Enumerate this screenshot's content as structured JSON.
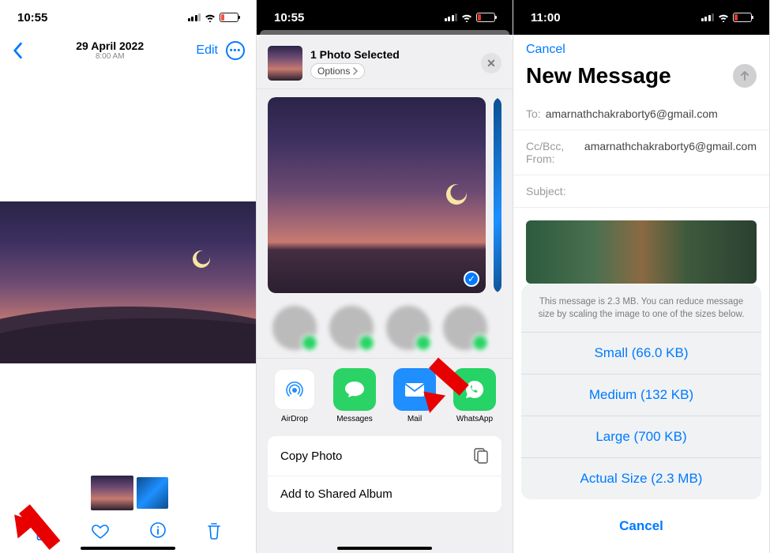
{
  "panel1": {
    "status": {
      "time": "10:55"
    },
    "nav": {
      "date": "29 April 2022",
      "time": "8:00 AM",
      "edit": "Edit"
    }
  },
  "panel2": {
    "status": {
      "time": "10:55"
    },
    "sheet": {
      "title": "1 Photo Selected",
      "options_label": "Options",
      "apps": [
        {
          "name": "AirDrop"
        },
        {
          "name": "Messages"
        },
        {
          "name": "Mail"
        },
        {
          "name": "WhatsApp"
        }
      ],
      "actions": [
        {
          "label": "Copy Photo"
        },
        {
          "label": "Add to Shared Album"
        }
      ]
    }
  },
  "panel3": {
    "status": {
      "time": "11:00"
    },
    "cancel": "Cancel",
    "title": "New Message",
    "to_label": "To:",
    "to_value": "amarnathchakraborty6@gmail.com",
    "ccbcc_label": "Cc/Bcc, From:",
    "ccbcc_value": "amarnathchakraborty6@gmail.com",
    "subject_label": "Subject:",
    "sheet": {
      "message": "This message is 2.3 MB. You can reduce message size by scaling the image to one of the sizes below.",
      "options": [
        "Small (66.0 KB)",
        "Medium (132 KB)",
        "Large (700 KB)",
        "Actual Size (2.3 MB)"
      ],
      "cancel": "Cancel"
    }
  }
}
